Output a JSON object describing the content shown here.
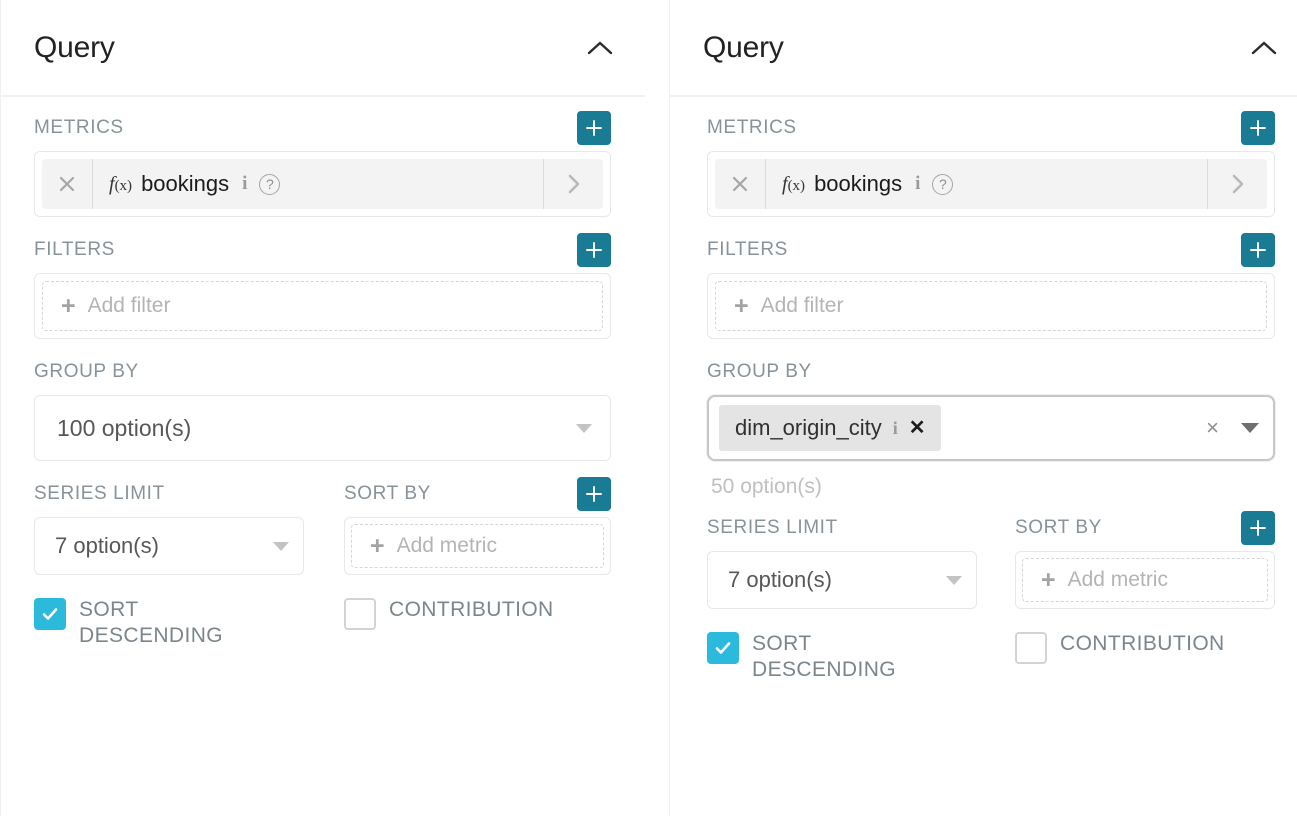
{
  "panels": [
    {
      "id": "left",
      "title": "Query",
      "collapse_icon": "chevron-up-icon",
      "metrics": {
        "label": "METRICS",
        "add_icon": "plus-icon",
        "chip": {
          "remove_icon": "close-icon",
          "fx": "f",
          "fx_arg": "(x)",
          "name": "bookings",
          "info_icon": "info-icon",
          "help_icon": "question-circle-icon",
          "expand_icon": "chevron-right-icon"
        }
      },
      "filters": {
        "label": "FILTERS",
        "add_icon": "plus-icon",
        "placeholder": "Add filter",
        "plus_glyph": "+"
      },
      "group_by": {
        "label": "GROUP BY",
        "value": "100 option(s)",
        "caret_icon": "chevron-down-icon",
        "focused": false,
        "tags": [],
        "helper": ""
      },
      "series_limit": {
        "label": "SERIES LIMIT",
        "value": "7 option(s)",
        "caret_icon": "chevron-down-icon"
      },
      "sort_by": {
        "label": "SORT BY",
        "add_icon": "plus-icon",
        "placeholder": "Add metric",
        "plus_glyph": "+"
      },
      "sort_descending": {
        "label": "SORT DESCENDING",
        "checked": true
      },
      "contribution": {
        "label": "CONTRIBUTION",
        "checked": false
      }
    },
    {
      "id": "right",
      "title": "Query",
      "collapse_icon": "chevron-up-icon",
      "metrics": {
        "label": "METRICS",
        "add_icon": "plus-icon",
        "chip": {
          "remove_icon": "close-icon",
          "fx": "f",
          "fx_arg": "(x)",
          "name": "bookings",
          "info_icon": "info-icon",
          "help_icon": "question-circle-icon",
          "expand_icon": "chevron-right-icon"
        }
      },
      "filters": {
        "label": "FILTERS",
        "add_icon": "plus-icon",
        "placeholder": "Add filter",
        "plus_glyph": "+"
      },
      "group_by": {
        "label": "GROUP BY",
        "value": "",
        "caret_icon": "chevron-down-icon",
        "focused": true,
        "tags": [
          {
            "text": "dim_origin_city",
            "info_icon": "info-icon",
            "remove_icon": "close-icon",
            "remove_glyph": "✕"
          }
        ],
        "clear_glyph": "×",
        "helper": "50 option(s)"
      },
      "series_limit": {
        "label": "SERIES LIMIT",
        "value": "7 option(s)",
        "caret_icon": "chevron-down-icon"
      },
      "sort_by": {
        "label": "SORT BY",
        "add_icon": "plus-icon",
        "placeholder": "Add metric",
        "plus_glyph": "+"
      },
      "sort_descending": {
        "label": "SORT DESCENDING",
        "checked": true
      },
      "contribution": {
        "label": "CONTRIBUTION",
        "checked": false
      }
    }
  ],
  "colors": {
    "add_button": "#1a7b95",
    "checkbox_checked": "#2bb9dc",
    "label_text": "#879399",
    "title_text": "#222222",
    "border": "#e8e8e8",
    "chip_bg": "#f3f3f3",
    "tag_bg": "#e4e4e4",
    "placeholder_text": "#b4b4b4"
  }
}
